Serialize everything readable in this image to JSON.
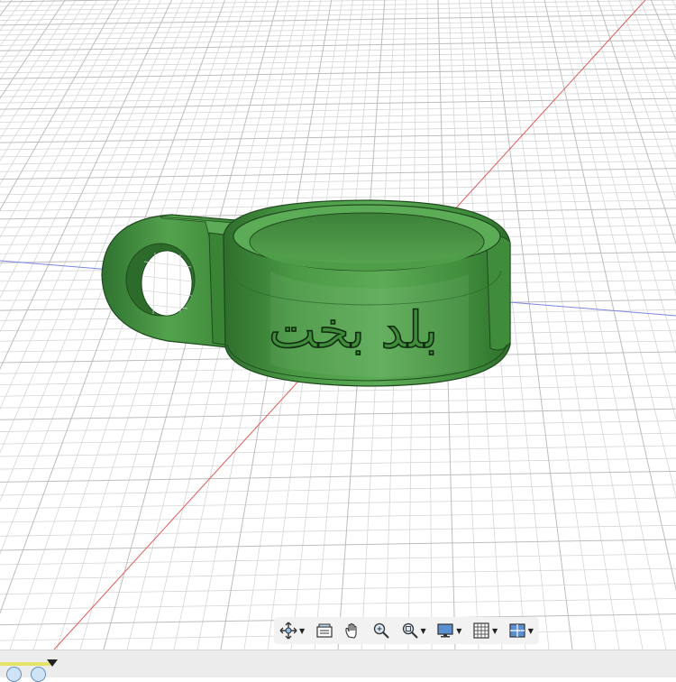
{
  "model": {
    "engraving_text": "بلد بخت",
    "body_color": "#3d8b3a",
    "body_shadow": "#2e6e2c",
    "body_highlight": "#5cab56"
  },
  "viewport": {
    "background": "#ffffff",
    "grid_color": "#d2d2d2",
    "x_axis_color": "#e05a5a",
    "y_axis_color": "#7b86e0"
  },
  "toolbar": {
    "tools": [
      {
        "name": "orbit-icon",
        "has_menu": true
      },
      {
        "name": "look-at-icon",
        "has_menu": false
      },
      {
        "name": "pan-icon",
        "has_menu": false
      },
      {
        "name": "zoom-icon",
        "has_menu": false
      },
      {
        "name": "fit-icon",
        "has_menu": true
      },
      {
        "name": "display-settings-icon",
        "has_menu": true
      },
      {
        "name": "grid-icon",
        "has_menu": true
      },
      {
        "name": "viewports-icon",
        "has_menu": true
      }
    ]
  },
  "timeline": {
    "marker_color": "#e3e36a",
    "feature_icons": [
      "extrude-feature-icon",
      "revolve-feature-icon"
    ]
  }
}
